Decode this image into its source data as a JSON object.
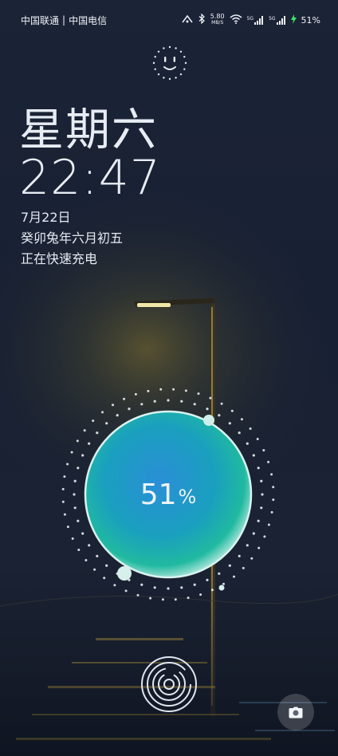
{
  "status_bar": {
    "carriers": [
      "中国联通",
      "中国电信"
    ],
    "separator": "|",
    "net_speed_value": "5.80",
    "net_speed_unit": "MB/S",
    "sim1_label": "5G",
    "sim2_label": "5G",
    "battery": "51%"
  },
  "lock": {
    "weekday": "星期六",
    "time": "22:47",
    "date": "7月22日",
    "lunar_date": "癸卯兔年六月初五",
    "charging_status": "正在快速充电"
  },
  "charging": {
    "percent_number": "51",
    "percent_sign": "%",
    "level": 0.51
  },
  "icons": {
    "face_unlock": "face-unlock-icon",
    "fingerprint": "fingerprint-icon",
    "camera": "camera-icon"
  },
  "colors": {
    "accent_charge": "#35e86a",
    "bubble_center": "#1f9fd0",
    "bubble_edge": "#19b89a"
  }
}
